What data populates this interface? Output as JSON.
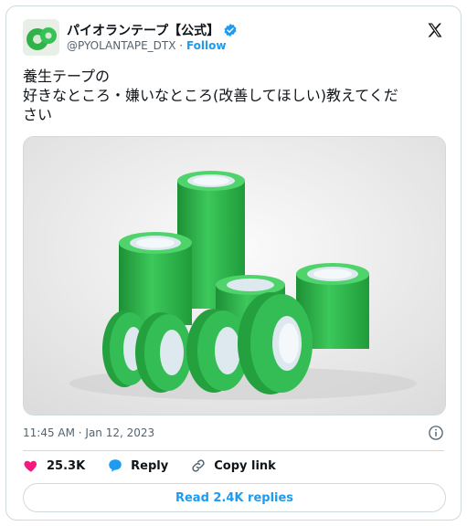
{
  "account": {
    "display_name": "パイオランテープ【公式】",
    "handle": "@PYOLANTAPE_DTX",
    "follow_label": "Follow",
    "separator": "·"
  },
  "tweet": {
    "line1": "養生テープの",
    "line2": "好きなところ・嫌いなところ(改善してほしい)教えてくだ",
    "line3": "さい",
    "timestamp": "11:45 AM · Jan 12, 2023"
  },
  "actions": {
    "likes": "25.3K",
    "reply_label": "Reply",
    "copy_label": "Copy link",
    "read_replies": "Read 2.4K replies"
  },
  "colors": {
    "accent": "#1d9bf0",
    "like": "#f91880",
    "tape_green": "#2fb24a"
  },
  "icons": {
    "verified": "verified-badge-icon",
    "x": "x-logo-icon",
    "info": "info-icon",
    "heart": "heart-icon",
    "reply": "reply-icon",
    "link": "link-icon"
  }
}
